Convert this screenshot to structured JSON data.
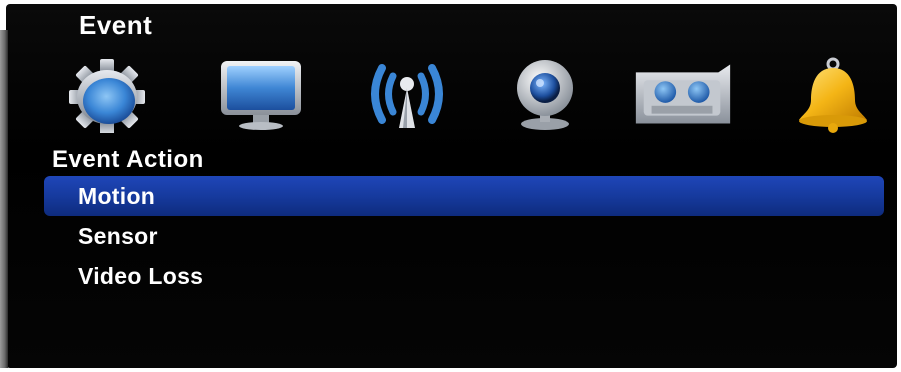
{
  "title": "Event",
  "icons": [
    {
      "name": "gear-icon",
      "color": "#3f86d4"
    },
    {
      "name": "monitor-icon",
      "color": "#3f86d4"
    },
    {
      "name": "network-antenna-icon",
      "color": "#3f86d4"
    },
    {
      "name": "webcam-icon",
      "color": "#3f86d4"
    },
    {
      "name": "tape-recorder-icon",
      "color": "#3f86d4"
    },
    {
      "name": "bell-icon",
      "color": "#f2b20a"
    }
  ],
  "section_header": "Event Action",
  "menu": {
    "items": [
      {
        "label": "Motion",
        "selected": true
      },
      {
        "label": "Sensor",
        "selected": false
      },
      {
        "label": "Video Loss",
        "selected": false
      }
    ]
  },
  "colors": {
    "background": "#000000",
    "selection": "#1a3fa8",
    "text": "#ffffff"
  }
}
